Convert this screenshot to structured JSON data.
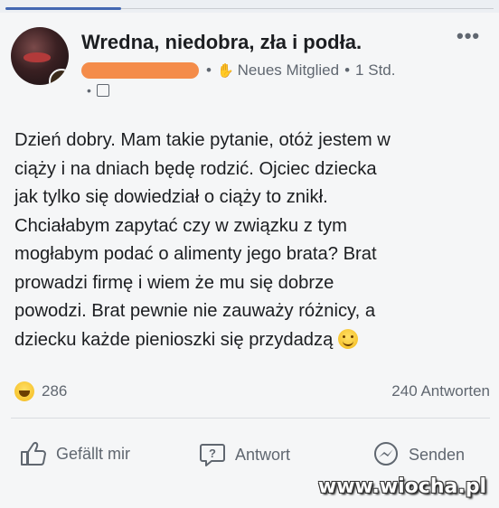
{
  "post": {
    "author": "Wredna, niedobra, zła i podła.",
    "meta_separator": "•",
    "meta_badge": "Neues Mitglied",
    "meta_time": "1 Std.",
    "privacy_prefix": "•",
    "text_lines": [
      "Dzień dobry. Mam takie pytanie, otóż jestem w",
      "ciąży i na dniach będę rodzić. Ojciec dziecka",
      "jak tylko się dowiedział o ciąży to znikł.",
      "Chciałabym zapytać czy w związku z tym",
      "mogłabym podać o alimenty jego brata? Brat",
      "prowadzi firmę i wiem że mu się dobrze",
      "powodzi. Brat pewnie nie zauważy różnicy, a",
      "dziecku każde pienioszki się przydadzą"
    ],
    "reaction_count": "286",
    "answers_count": "240 Antworten"
  },
  "actions": {
    "like_label": "Gefällt mir",
    "answer_label": "Antwort",
    "send_label": "Senden"
  },
  "icons": {
    "more": "more-options-icon",
    "wave": "wave-hand-icon",
    "globe": "privacy-icon",
    "smile": "smiling-face-emoji",
    "haha": "haha-reaction-icon",
    "like": "thumbs-up-icon",
    "answer": "speech-bubble-question-icon",
    "send": "messenger-icon"
  },
  "colors": {
    "accent": "#4267b2",
    "text": "#1c1e21",
    "secondary": "#606770",
    "redaction": "#f48c4a"
  },
  "watermark": "www.wiocha.pl"
}
